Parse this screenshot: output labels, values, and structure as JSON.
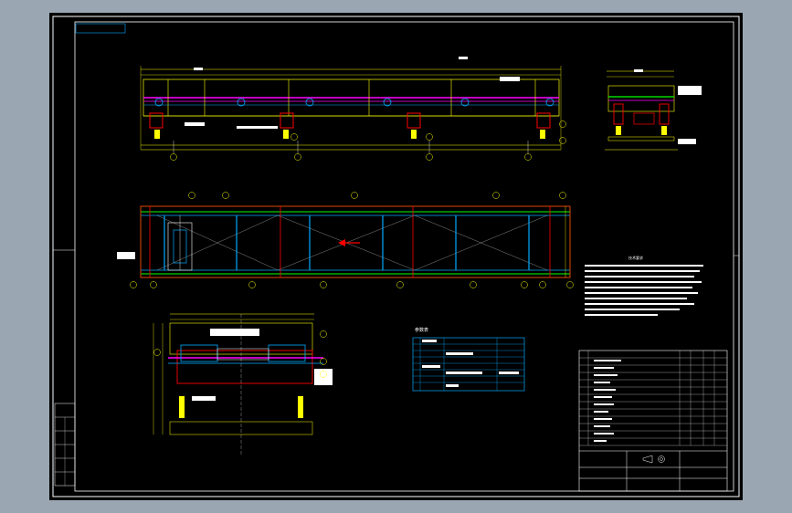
{
  "drawing": {
    "background_color": "#000000",
    "border_color": "#ffffff",
    "line_colors": {
      "dimension": "#ffff00",
      "steel": "#ff00ff",
      "frame": "#00ff00",
      "support": "#ff0000",
      "roller": "#00aaff",
      "centerline": "#ffffff"
    }
  },
  "views": {
    "side_view": {
      "section_marker": "A"
    },
    "end_view": {
      "section_marker": "A-A"
    },
    "plan_view": {
      "flow_direction": "left"
    },
    "section_view": {
      "section_marker": "B-B"
    }
  },
  "technical_requirements": {
    "title": "技术要求"
  },
  "table": {
    "title": "参数表"
  },
  "title_block": {
    "scale_icon": "projection-symbol-icon"
  }
}
